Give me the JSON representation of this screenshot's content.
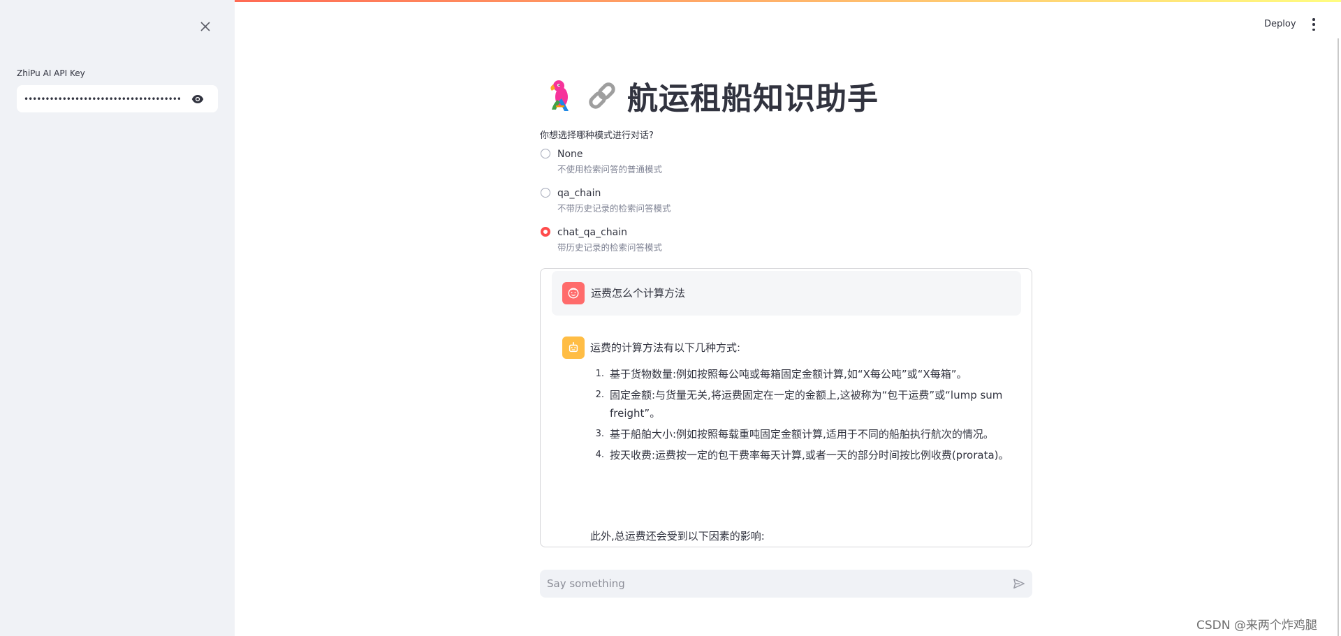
{
  "sidebar": {
    "api_key_label": "ZhiPu AI API Key",
    "api_key_masked": "••••••••••••••••••••••••••••••••••••••••••••••••"
  },
  "header": {
    "deploy_label": "Deploy"
  },
  "main": {
    "title": "航运租船知识助手",
    "radio_question": "你想选择哪种模式进行对话?",
    "options": [
      {
        "label": "None",
        "caption": "不使用检索问答的普通模式",
        "selected": false
      },
      {
        "label": "qa_chain",
        "caption": "不带历史记录的检索问答模式",
        "selected": false
      },
      {
        "label": "chat_qa_chain",
        "caption": "带历史记录的检索问答模式",
        "selected": true
      }
    ]
  },
  "chat": {
    "user_message": "运费怎么个计算方法",
    "ai_intro": "运费的计算方法有以下几种方式:",
    "ai_items": [
      {
        "num": "1.",
        "text": "基于货物数量:例如按照每公吨或每箱固定金额计算,如“X每公吨”或“X每箱”。"
      },
      {
        "num": "2.",
        "text": "固定金额:与货量无关,将运费固定在一定的金额上,这被称为“包干运费”或“lump sum freight”。"
      },
      {
        "num": "3.",
        "text": "基于船舶大小:例如按照每载重吨固定金额计算,适用于不同的船舶执行航次的情况。"
      },
      {
        "num": "4.",
        "text": "按天收费:运费按一定的包干费率每天计算,或者一天的部分时间按比例收费(prorata)。"
      }
    ],
    "ai_footer": "此外,总运费还会受到以下因素的影响:",
    "input_placeholder": "Say something"
  },
  "watermark": "CSDN @来两个炸鸡腿",
  "colors": {
    "accent": "#ff4b4b",
    "sidebar_bg": "#f0f2f6",
    "user_avatar": "#ff6b6b",
    "bot_avatar": "#ffbd45"
  }
}
